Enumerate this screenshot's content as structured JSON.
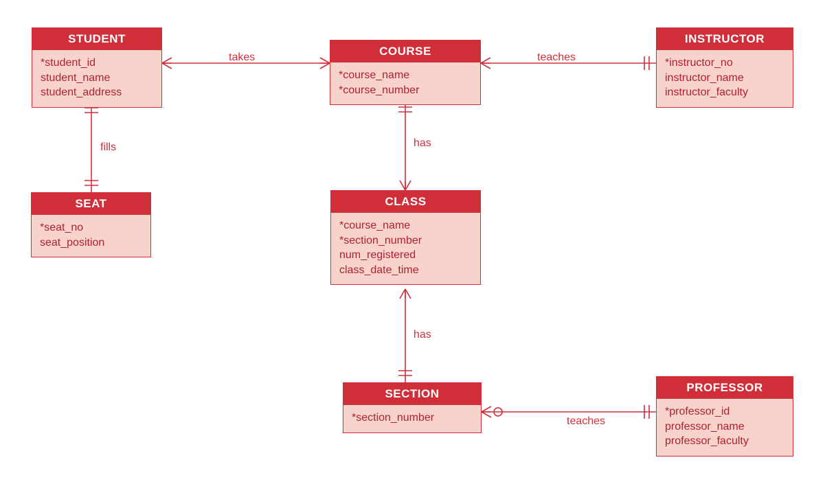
{
  "entities": {
    "student": {
      "title": "STUDENT",
      "attrs": [
        "*student_id",
        "student_name",
        "student_address"
      ]
    },
    "course": {
      "title": "COURSE",
      "attrs": [
        "*course_name",
        "*course_number"
      ]
    },
    "instructor": {
      "title": "INSTRUCTOR",
      "attrs": [
        "*instructor_no",
        "instructor_name",
        "instructor_faculty"
      ]
    },
    "seat": {
      "title": "SEAT",
      "attrs": [
        "*seat_no",
        "seat_position"
      ]
    },
    "class": {
      "title": "CLASS",
      "attrs": [
        "*course_name",
        "*section_number",
        "num_registered",
        "class_date_time"
      ]
    },
    "section": {
      "title": "SECTION",
      "attrs": [
        "*section_number"
      ]
    },
    "professor": {
      "title": "PROFESSOR",
      "attrs": [
        "*professor_id",
        "professor_name",
        "professor_faculty"
      ]
    }
  },
  "relationships": {
    "takes": "takes",
    "teaches_instructor": "teaches",
    "fills": "fills",
    "has_class": "has",
    "has_section": "has",
    "teaches_professor": "teaches"
  },
  "colors": {
    "header_bg": "#d02f3a",
    "body_bg": "#f7d3cb",
    "line": "#d02f3a",
    "text": "#b02030"
  }
}
